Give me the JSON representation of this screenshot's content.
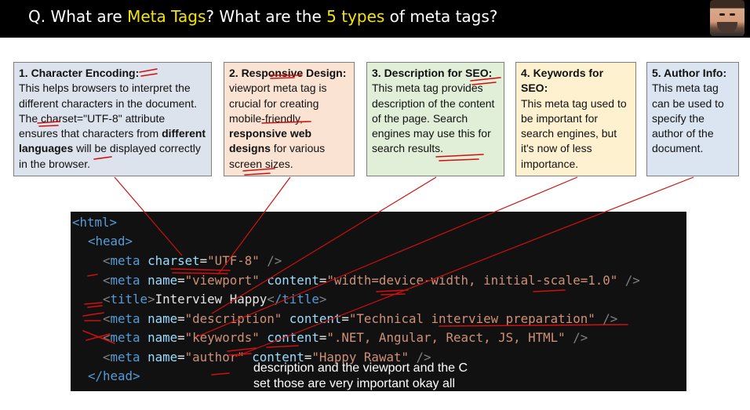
{
  "header": {
    "q_prefix": "Q. What are ",
    "q_hl1": "Meta Tags",
    "q_mid": "? What are the ",
    "q_hl2": "5 types",
    "q_suffix": " of meta tags?"
  },
  "cards": [
    {
      "title": "1. Character Encoding:",
      "p1": "This helps browsers to interpret the different characters in the document. The charset=\"UTF-8\" attribute ensures that characters from ",
      "b1": "different languages",
      "p2": " will be displayed correctly in the browser."
    },
    {
      "title": "2. Responsive Design:",
      "p1": "viewport meta tag is crucial for creating mobile-friendly, ",
      "b1": "responsive web designs",
      "p2": " for various screen sizes."
    },
    {
      "title": "3. Description for SEO:",
      "p1": "This meta tag provides description of the content of the page. Search engines may use this for search results."
    },
    {
      "title": "4. Keywords for SEO:",
      "p1": "This meta tag used to be important for search engines, but it's now of less importance."
    },
    {
      "title": "5. Author Info:",
      "p1": "This meta tag can be used to specify the author of the document."
    }
  ],
  "code": {
    "html_open": "<html>",
    "head_open": "<head>",
    "meta1": {
      "tag": "meta",
      "attr": "charset",
      "val": "\"UTF-8\""
    },
    "meta2": {
      "tag": "meta",
      "attr1": "name",
      "val1": "\"viewport\"",
      "attr2": "content",
      "val2": "\"width=device-width, initial-scale=1.0\""
    },
    "title": {
      "open": "title",
      "text": "Interview Happy",
      "close": "/title"
    },
    "meta3": {
      "tag": "meta",
      "attr1": "name",
      "val1": "\"description\"",
      "attr2": "content",
      "val2": "\"Technical interview preparation\""
    },
    "meta4": {
      "tag": "meta",
      "attr1": "name",
      "val1": "\"keywords\"",
      "attr2": "content",
      "val2": "\".NET, Angular, React, JS, HTML\""
    },
    "meta5": {
      "tag": "meta",
      "attr1": "name",
      "val1": "\"author\"",
      "attr2": "content",
      "val2": "\"Happy Rawat\""
    },
    "head_close": "</head>"
  },
  "caption": {
    "line1": "description and the viewport and the C",
    "line2": "set those are very important okay all"
  },
  "colors": {
    "highlight": "#f5e400",
    "annotation": "#cc1111"
  }
}
